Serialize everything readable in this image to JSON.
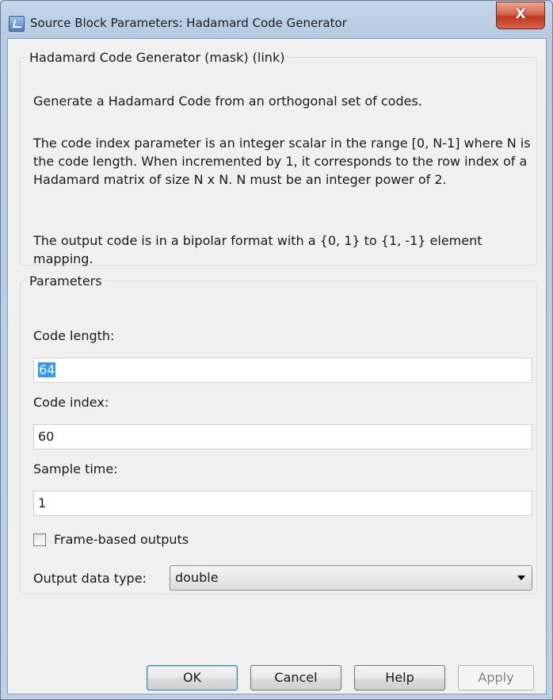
{
  "window": {
    "title": "Source Block Parameters: Hadamard Code Generator",
    "close_glyph": "X",
    "icon": "simulink-block-icon"
  },
  "description": {
    "legend": "Hadamard Code Generator (mask) (link)",
    "paragraphs": [
      "Generate a Hadamard Code from an orthogonal set of codes.",
      "The code index parameter is an integer scalar in the range [0, N-1] where N is the code length.  When incremented by 1, it corresponds to the row index of a Hadamard matrix of size N x N. N must be an integer power of 2.",
      "The output code is in a bipolar format with a {0, 1} to {1, -1} element mapping."
    ]
  },
  "parameters": {
    "legend": "Parameters",
    "code_length": {
      "label": "Code length:",
      "value": "64"
    },
    "code_index": {
      "label": "Code index:",
      "value": "60"
    },
    "sample_time": {
      "label": "Sample time:",
      "value": "1"
    },
    "frame_based": {
      "label": "Frame-based outputs",
      "checked": false
    },
    "output_type": {
      "label": "Output data type:",
      "value": "double"
    }
  },
  "buttons": {
    "ok": "OK",
    "cancel": "Cancel",
    "help": "Help",
    "apply": "Apply"
  }
}
